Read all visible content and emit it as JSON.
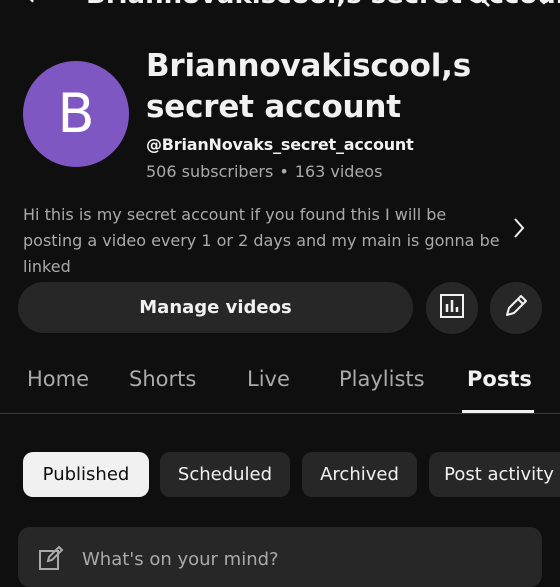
{
  "header": {
    "title": "Briannovakiscool,s secret account"
  },
  "channel": {
    "avatar_letter": "B",
    "avatar_color": "#7e57c2",
    "name": "Briannovakiscool,s secret account",
    "handle": "@BrianNovaks_secret_account",
    "subscribers": "506 subscribers",
    "separator": "•",
    "videos": "163 videos",
    "description": "Hi this is my secret account if you found this I will be posting a video every 1 or 2 days and my main is gonna be linked"
  },
  "actions": {
    "manage_videos": "Manage videos",
    "analytics_icon": "analytics-icon",
    "edit_icon": "pencil-icon"
  },
  "tabs": [
    {
      "label": "Home",
      "active": false
    },
    {
      "label": "Shorts",
      "active": false
    },
    {
      "label": "Live",
      "active": false
    },
    {
      "label": "Playlists",
      "active": false
    },
    {
      "label": "Posts",
      "active": true
    }
  ],
  "filters": [
    {
      "label": "Published",
      "selected": true
    },
    {
      "label": "Scheduled",
      "selected": false
    },
    {
      "label": "Archived",
      "selected": false
    },
    {
      "label": "Post activity",
      "selected": false
    }
  ],
  "composer": {
    "placeholder": "What's on your mind?"
  },
  "colors": {
    "background": "#0f0f0f",
    "surface": "#272727",
    "text": "#f1f1f1",
    "secondary_text": "#aaaaaa"
  }
}
